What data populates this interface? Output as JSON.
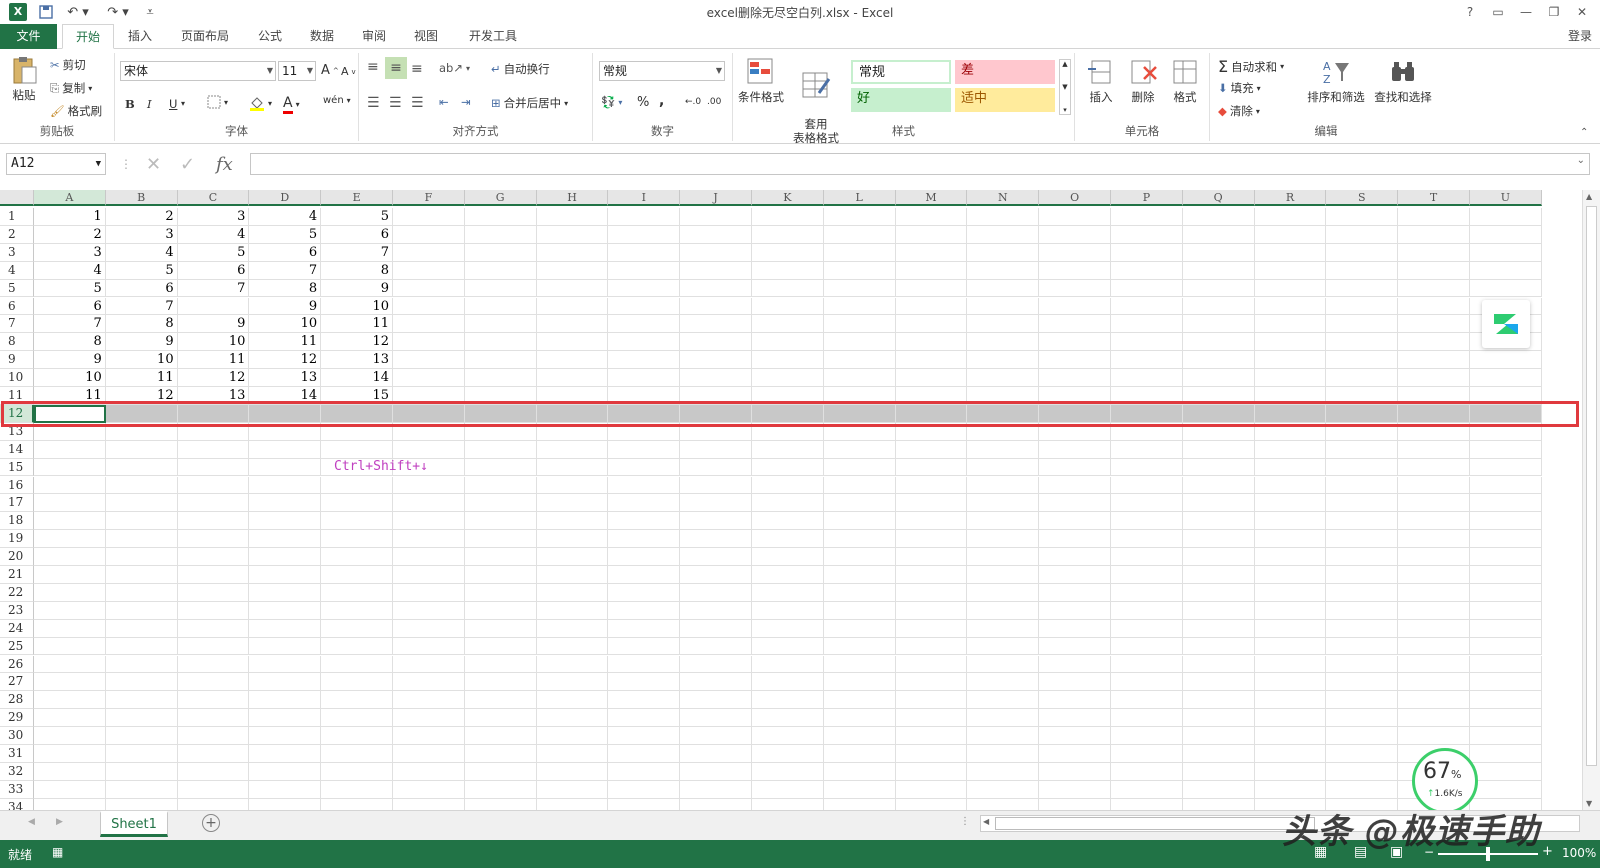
{
  "window": {
    "title": "excel删除无尽空白列.xlsx - Excel",
    "help": "?",
    "login": "登录"
  },
  "tabs": [
    "文件",
    "开始",
    "插入",
    "页面布局",
    "公式",
    "数据",
    "审阅",
    "视图",
    "开发工具"
  ],
  "clipboard": {
    "paste": "粘贴",
    "cut": "剪切",
    "copy": "复制",
    "painter": "格式刷",
    "label": "剪贴板"
  },
  "font": {
    "name": "宋体",
    "size": "11",
    "label": "字体",
    "bold": "B",
    "italic": "I",
    "underline": "U"
  },
  "align": {
    "wrap": "自动换行",
    "merge": "合并后居中",
    "label": "对齐方式"
  },
  "number": {
    "format": "常规",
    "percent": "%",
    "comma": ",",
    "label": "数字"
  },
  "styles": {
    "cond": "条件格式",
    "table": "套用\n表格格式",
    "normal": "常规",
    "bad": "差",
    "good": "好",
    "neutral": "适中",
    "label": "样式"
  },
  "cells": {
    "insert": "插入",
    "delete": "删除",
    "format": "格式",
    "label": "单元格"
  },
  "editing": {
    "autosum": "自动求和",
    "fill": "填充",
    "clear": "清除",
    "sort": "排序和筛选",
    "find": "查找和选择",
    "label": "编辑"
  },
  "formula_bar": {
    "name_box": "A12",
    "fx": "fx",
    "value": ""
  },
  "columns": [
    "A",
    "B",
    "C",
    "D",
    "E",
    "F",
    "G",
    "H",
    "I",
    "J",
    "K",
    "L",
    "M",
    "N",
    "O",
    "P",
    "Q",
    "R",
    "S",
    "T",
    "U"
  ],
  "rows": [
    "1",
    "2",
    "3",
    "4",
    "5",
    "6",
    "7",
    "8",
    "9",
    "10",
    "11",
    "12",
    "13",
    "14",
    "15",
    "16",
    "17",
    "18",
    "19",
    "20",
    "21",
    "22",
    "23",
    "24",
    "25",
    "26",
    "27",
    "28",
    "29",
    "30",
    "31",
    "32",
    "33",
    "34"
  ],
  "data": [
    [
      "1",
      "2",
      "3",
      "4",
      "5"
    ],
    [
      "2",
      "3",
      "4",
      "5",
      "6"
    ],
    [
      "3",
      "4",
      "5",
      "6",
      "7"
    ],
    [
      "4",
      "5",
      "6",
      "7",
      "8"
    ],
    [
      "5",
      "6",
      "7",
      "8",
      "9"
    ],
    [
      "6",
      "7",
      "",
      "9",
      "10"
    ],
    [
      "7",
      "8",
      "9",
      "10",
      "11"
    ],
    [
      "8",
      "9",
      "10",
      "11",
      "12"
    ],
    [
      "9",
      "10",
      "11",
      "12",
      "13"
    ],
    [
      "10",
      "11",
      "12",
      "13",
      "14"
    ],
    [
      "11",
      "12",
      "13",
      "14",
      "15"
    ]
  ],
  "annotation": "Ctrl+Shift+↓",
  "sheet_tab": "Sheet1",
  "status": {
    "ready": "就绪",
    "zoom": "100%"
  },
  "speed": {
    "percent": "67",
    "percent_sign": "%",
    "rate": "1.6K/s"
  },
  "watermark": "头条 @极速手助",
  "colors": {
    "excel_green": "#217346",
    "highlight": "#e0393e",
    "good_bg": "#c6efce",
    "bad_bg": "#ffc7ce",
    "neutral_bg": "#ffeb9c",
    "annotation": "#c040c0"
  }
}
